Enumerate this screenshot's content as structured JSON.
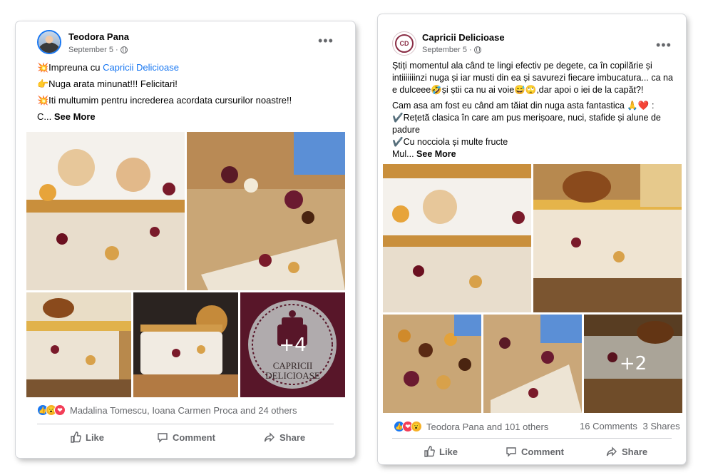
{
  "post1": {
    "author": "Teodora Pana",
    "date": "September 5 ·",
    "text": {
      "line1_prefix": "💥Impreuna cu ",
      "line1_link": "Capricii Delicioase",
      "line2": "👉Nuga arata minunat!!! Felicitari!",
      "line3": "💥Iti multumim pentru increderea acordata cursurilor noastre!!",
      "line4_prefix": "C... ",
      "see_more": "See More"
    },
    "more_photos": "+4",
    "reaction_summary": "Madalina Tomescu, Ioana Carmen Proca and 24 others",
    "actions": {
      "like": "Like",
      "comment": "Comment",
      "share": "Share"
    }
  },
  "post2": {
    "author": "Capricii Delicioase",
    "avatar_text": "CD",
    "date": "September 5 ·",
    "text": {
      "p1": "Știți momentul ala când te lingi efectiv pe degete, ca în copilărie și intiiiiiiinzi nuga și iar musti din ea și savurezi fiecare imbucatura... ca na e dulceee🤣și știi ca nu ai voie😅🙄,dar apoi o iei de la capăt?!",
      "p2a": "Cam asa am fost eu când am tăiat din nuga asta fantastica 🙏❤️ :",
      "p2b": "✔️Rețetă clasica în care am pus  merișoare, nuci, stafide și alune de padure",
      "p2c": "✔️Cu nocciola și multe fructe",
      "p2d_prefix": "Mul... ",
      "see_more": "See More"
    },
    "more_photos": "+2",
    "reaction_summary": "Teodora Pana and 101 others",
    "comments_count": "16 Comments",
    "shares_count": "3 Shares",
    "actions": {
      "like": "Like",
      "comment": "Comment",
      "share": "Share"
    }
  },
  "logo": {
    "line1": "CAPRICII",
    "line2": "DELICIOASE"
  },
  "icons": [
    "globe-icon",
    "more-options-icon",
    "like-reaction-icon",
    "love-reaction-icon",
    "wow-reaction-icon",
    "thumbs-up-icon",
    "comment-icon",
    "share-icon"
  ],
  "colors": {
    "link": "#1877f2",
    "secondary_text": "#65676b",
    "brand_burgundy": "#7a1f3a"
  }
}
